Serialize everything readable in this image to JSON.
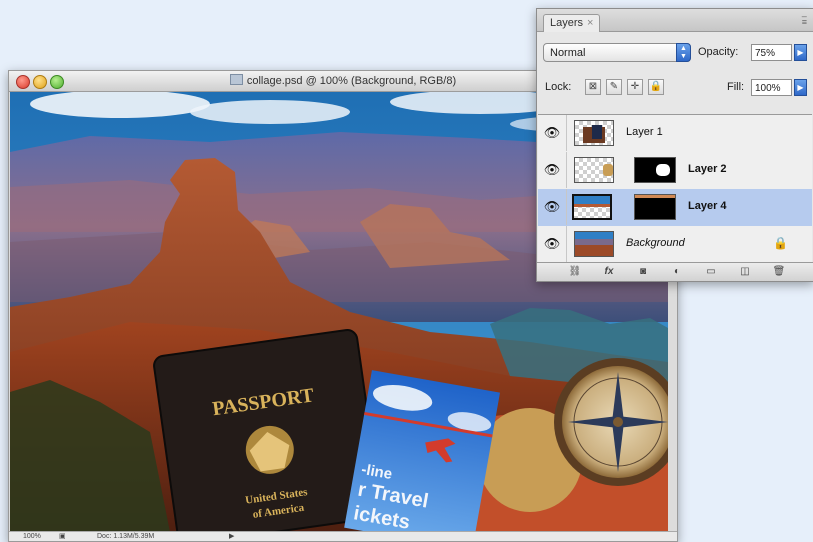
{
  "document": {
    "title": "collage.psd @ 100% (Background, RGB/8)",
    "status": {
      "zoom": "100%",
      "doc_info": "Doc: 1.13M/5.39M"
    }
  },
  "collage": {
    "passport_line1": "PASSPORT",
    "passport_line2": "United States",
    "passport_line3": "of America",
    "ticket_line1": "-line",
    "ticket_line2": "r Travel",
    "ticket_line3": "ickets"
  },
  "layers_panel": {
    "tab_label": "Layers",
    "tab_close": "×",
    "blend_mode": "Normal",
    "opacity_label": "Opacity:",
    "opacity_value": "75%",
    "lock_label": "Lock:",
    "fill_label": "Fill:",
    "fill_value": "100%",
    "layers": [
      {
        "name": "Layer 1",
        "visible": true,
        "selected": false
      },
      {
        "name": "Layer 2",
        "visible": true,
        "selected": false
      },
      {
        "name": "Layer 4",
        "visible": true,
        "selected": true
      },
      {
        "name": "Background",
        "visible": true,
        "selected": false,
        "locked": true
      }
    ],
    "footer_buttons": [
      "link-layers-icon",
      "fx-icon",
      "add-mask-icon",
      "adjustment-layer-icon",
      "new-group-icon",
      "new-layer-icon",
      "trash-icon"
    ]
  },
  "colors": {
    "selection_highlight": "#b6cbee",
    "accent_blue": "#2f68c8",
    "page_background": "#e6effa"
  }
}
